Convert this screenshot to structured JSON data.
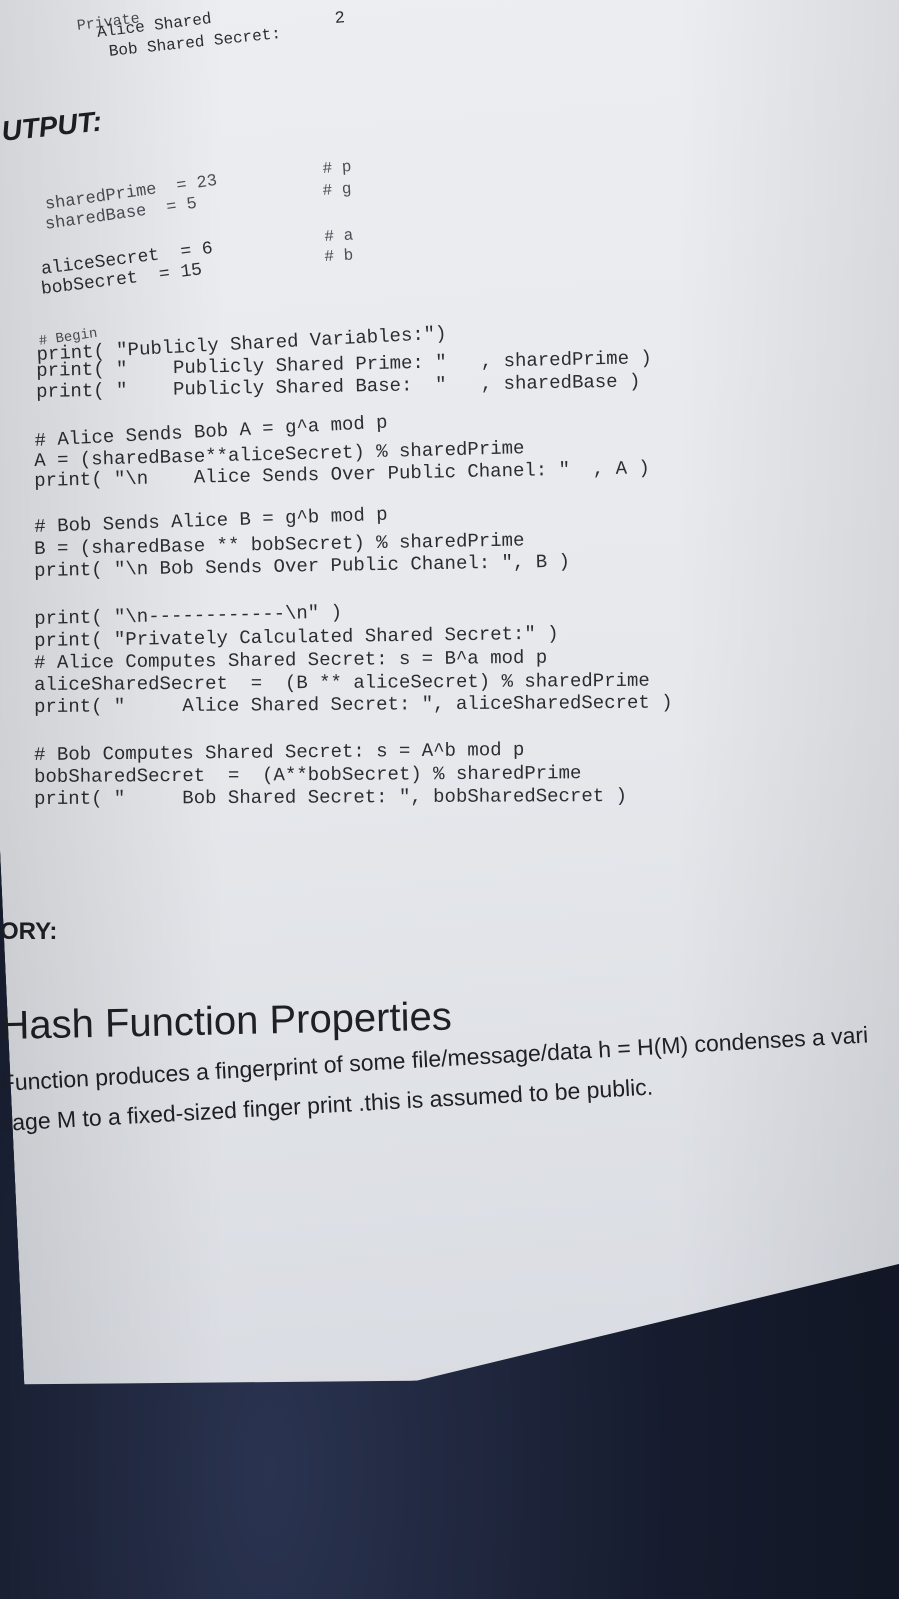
{
  "top": {
    "l1": "Private",
    "l2": "Alice Shared",
    "l3": "Bob Shared Secret:",
    "l3v": "2"
  },
  "output_heading": "UTPUT:",
  "code": {
    "c1": "sharedPrime  = 23",
    "c1n": "# p",
    "c2": "sharedBase  = 5",
    "c2n": "# g",
    "c3": "aliceSecret  = 6",
    "c3n": "# a",
    "c4": "bobSecret  = 15",
    "c4n": "# b",
    "c5": "# Begin",
    "c6": "print( \"Publicly Shared Variables:\")",
    "c7": "print( \"    Publicly Shared Prime: \"   , sharedPrime )",
    "c8": "print( \"    Publicly Shared Base:  \"   , sharedBase )",
    "c9": "# Alice Sends Bob A = g^a mod p",
    "c10": "A = (sharedBase**aliceSecret) % sharedPrime",
    "c11": "print( \"\\n    Alice Sends Over Public Chanel: \"  , A )",
    "c12": "# Bob Sends Alice B = g^b mod p",
    "c13": "B = (sharedBase ** bobSecret) % sharedPrime",
    "c14": "print( \"\\n Bob Sends Over Public Chanel: \", B )",
    "c15": "print( \"\\n------------\\n\" )",
    "c16": "print( \"Privately Calculated Shared Secret:\" )",
    "c17": "# Alice Computes Shared Secret: s = B^a mod p",
    "c18": "aliceSharedSecret  =  (B ** aliceSecret) % sharedPrime",
    "c19": "print( \"     Alice Shared Secret: \", aliceSharedSecret )",
    "c20": "# Bob Computes Shared Secret: s = A^b mod p",
    "c21": "bobSharedSecret  =  (A**bobSecret) % sharedPrime",
    "c22": "print( \"     Bob Shared Secret: \", bobSharedSecret )"
  },
  "theory_heading": "ORY:",
  "hash": {
    "title": "Hash Function Properties",
    "p1": "Function produces a fingerprint of some file/message/data h = H(M) condenses a vari",
    "p2": "sage M to a fixed-sized finger print .this is assumed to be public."
  }
}
